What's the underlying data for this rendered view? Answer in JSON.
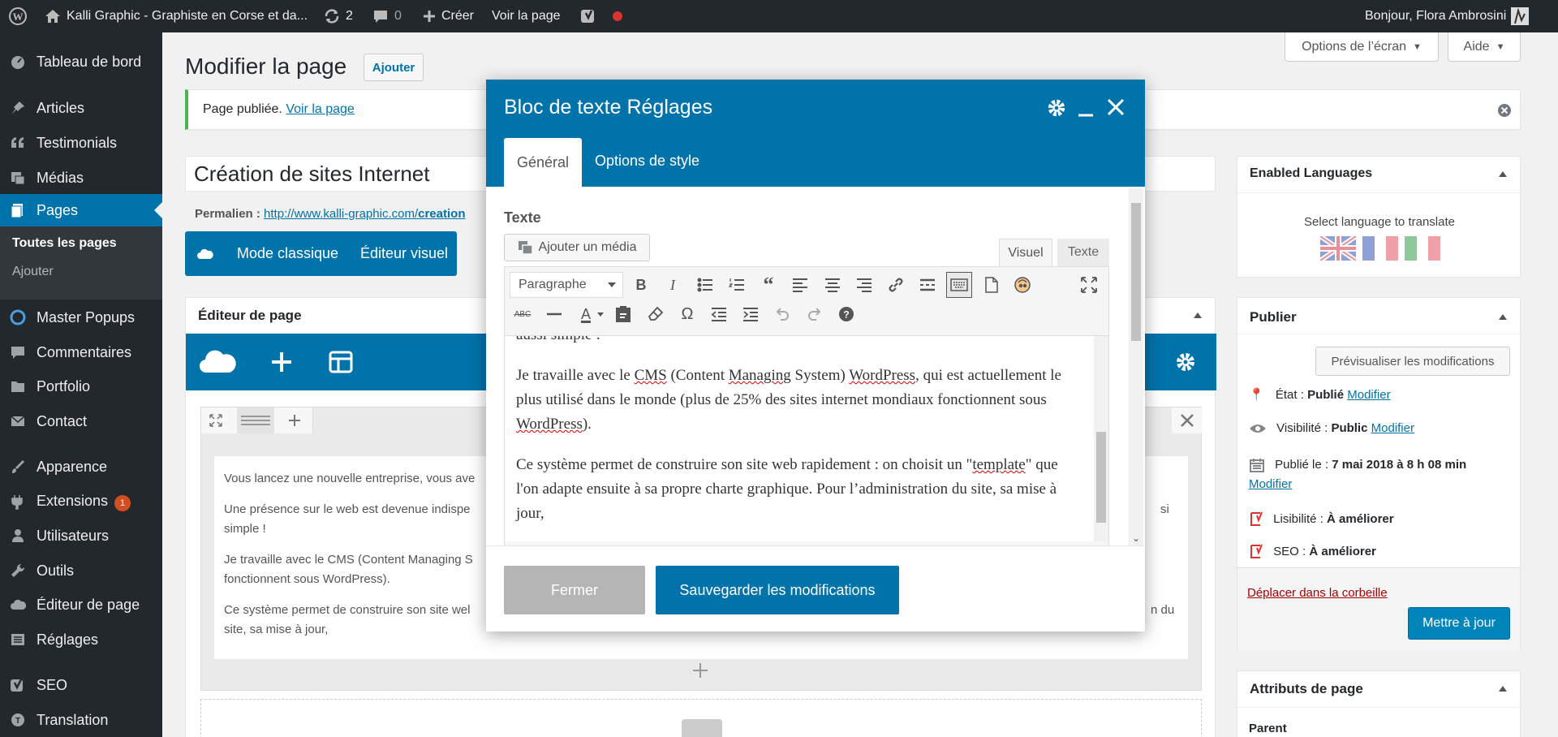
{
  "adminbar": {
    "site_name": "Kalli Graphic - Graphiste en Corse et da...",
    "updates_count": "2",
    "comments_count": "0",
    "new_label": "Créer",
    "view_page": "Voir la page",
    "greeting": "Bonjour, Flora Ambrosini"
  },
  "sidebar": {
    "items": [
      {
        "label": "Tableau de bord",
        "icon": "dashboard-icon"
      },
      {
        "label": "Articles",
        "icon": "pin-icon"
      },
      {
        "label": "Testimonials",
        "icon": "quote-icon"
      },
      {
        "label": "Médias",
        "icon": "media-icon"
      },
      {
        "label": "Pages",
        "icon": "pages-icon"
      },
      {
        "label": "Master Popups",
        "icon": "popup-icon"
      },
      {
        "label": "Commentaires",
        "icon": "comment-icon"
      },
      {
        "label": "Portfolio",
        "icon": "folder-icon"
      },
      {
        "label": "Contact",
        "icon": "mail-icon"
      },
      {
        "label": "Apparence",
        "icon": "brush-icon"
      },
      {
        "label": "Extensions",
        "icon": "plugin-icon",
        "badge": "1"
      },
      {
        "label": "Utilisateurs",
        "icon": "user-icon"
      },
      {
        "label": "Outils",
        "icon": "wrench-icon"
      },
      {
        "label": "Éditeur de page",
        "icon": "cloud-icon"
      },
      {
        "label": "Réglages",
        "icon": "settings-icon"
      },
      {
        "label": "SEO",
        "icon": "yoast-icon"
      },
      {
        "label": "Translation",
        "icon": "translation-icon"
      }
    ],
    "sub": {
      "all_pages": "Toutes les pages",
      "add": "Ajouter"
    }
  },
  "screen_options": "Options de l’écran",
  "help": "Aide",
  "page_heading": "Modifier la page",
  "add_button": "Ajouter",
  "notice": {
    "text": "Page publiée.",
    "link": "Voir la page"
  },
  "post_title": "Création de sites Internet",
  "permalink": {
    "label": "Permalien :",
    "url": "http://www.kalli-graphic.com/",
    "url_bold": "creation"
  },
  "builder_buttons": {
    "classic": "Mode classique",
    "visual": "Éditeur visuel"
  },
  "page_editor_title": "Éditeur de page",
  "bg_content": [
    "Vous lancez une nouvelle entreprise, vous ave",
    "Une présence sur le web est devenue indispe",
    "si",
    "simple !",
    "Je travaille avec le CMS (Content Managing S",
    "fonctionnent sous WordPress).",
    "Ce système permet de construire son site wel",
    "n du",
    "site, sa mise à jour,"
  ],
  "modal": {
    "title": "Bloc de texte Réglages",
    "tabs": [
      "Général",
      "Options de style"
    ],
    "field_label": "Texte",
    "add_media": "Ajouter un média",
    "editor_tabs": [
      "Visuel",
      "Texte"
    ],
    "format_select": "Paragraphe",
    "content": {
      "p0": "aussi simple !",
      "p1a": "Je travaille avec le ",
      "p1b": "CMS",
      "p1c": " (Content ",
      "p1d": "Managing",
      "p1e": " System) ",
      "p1f": "WordPress",
      "p1g": ", qui est actuellement le plus utilisé dans le monde (plus de 25% des sites internet mondiaux fonctionnent sous ",
      "p1h": "WordPress",
      "p1i": ").",
      "p2a": "Ce système permet de construire son site web rapidement : on choisit un \"",
      "p2b": "template",
      "p2c": "\" que l'on adapte ensuite à sa propre charte graphique. Pour l’administration du site, sa mise à jour,"
    },
    "close_button": "Fermer",
    "save_button": "Sauvegarder les modifications"
  },
  "languages": {
    "title": "Enabled Languages",
    "text": "Select language to translate"
  },
  "publish": {
    "title": "Publier",
    "preview": "Prévisualiser les modifications",
    "status_label": "État :",
    "status_value": "Publié",
    "visibility_label": "Visibilité :",
    "visibility_value": "Public",
    "published_label": "Publié le :",
    "published_value": "7 mai 2018 à 8 h 08 min",
    "modify": "Modifier",
    "readability_label": "Lisibilité :",
    "readability_value": "À améliorer",
    "seo_label": "SEO :",
    "seo_value": "À améliorer",
    "trash": "Déplacer dans la corbeille",
    "update": "Mettre à jour"
  },
  "attributes": {
    "title": "Attributs de page",
    "parent": "Parent"
  },
  "colors": {
    "accent": "#0073aa",
    "adminbar": "#23282d",
    "notice_green": "#46b450",
    "error": "#dc3232",
    "yoast": "#a4286a"
  }
}
